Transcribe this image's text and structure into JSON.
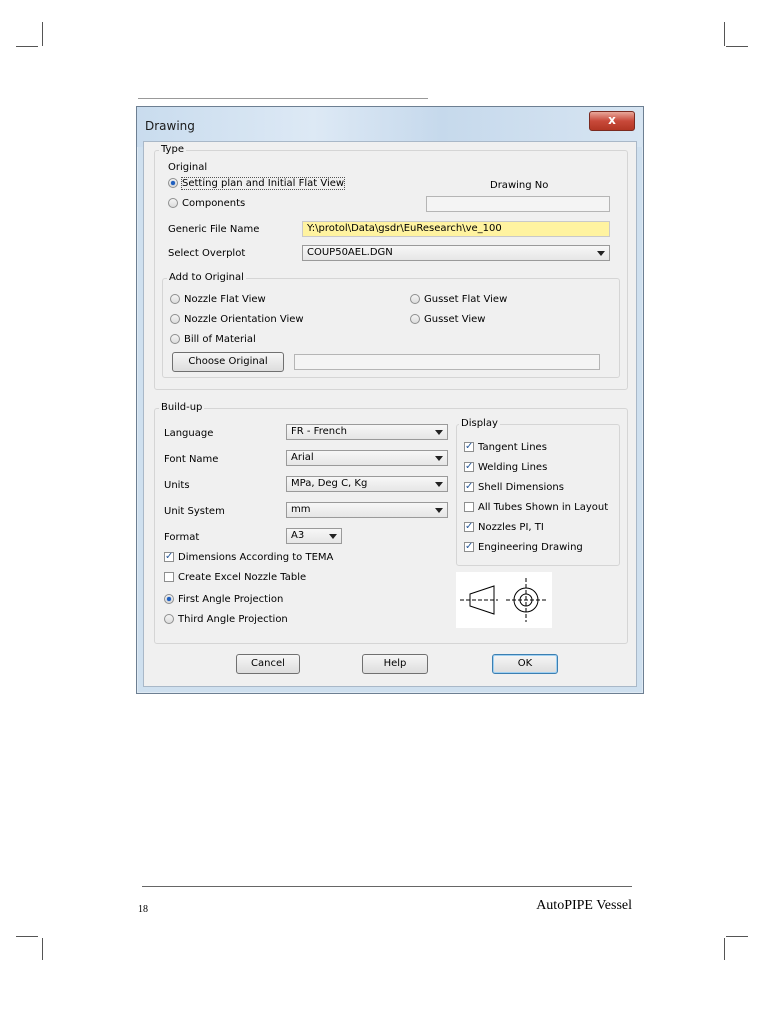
{
  "window": {
    "title": "Drawing",
    "close_label": "x"
  },
  "type_group": {
    "legend": "Type",
    "original_label": "Original",
    "radio_setting_plan": "Setting plan and Initial Flat View",
    "radio_components": "Components",
    "drawing_no_label": "Drawing No",
    "drawing_no_value": "",
    "generic_file_label": "Generic File Name",
    "generic_file_value": "Y:\\protol\\Data\\gsdr\\EuResearch\\ve_100",
    "select_overplot_label": "Select Overplot",
    "select_overplot_value": "COUP50AEL.DGN"
  },
  "add_group": {
    "legend": "Add to Original",
    "nozzle_flat": "Nozzle Flat View",
    "nozzle_orientation": "Nozzle Orientation View",
    "bill_of_material": "Bill of Material",
    "gusset_flat": "Gusset Flat View",
    "gusset_view": "Gusset View",
    "choose_original_button": "Choose Original",
    "choose_original_value": ""
  },
  "buildup_group": {
    "legend": "Build-up",
    "language_label": "Language",
    "language_value": "FR - French",
    "font_label": "Font Name",
    "font_value": "Arial",
    "units_label": "Units",
    "units_value": "MPa, Deg C, Kg",
    "unit_system_label": "Unit System",
    "unit_system_value": "mm",
    "format_label": "Format",
    "format_value": "A3",
    "dimensions_tema": "Dimensions According to TEMA",
    "create_excel": "Create Excel Nozzle Table",
    "first_angle": "First Angle Projection",
    "third_angle": "Third Angle Projection"
  },
  "display_group": {
    "legend": "Display",
    "tangent_lines": "Tangent Lines",
    "welding_lines": "Welding Lines",
    "shell_dimensions": "Shell Dimensions",
    "all_tubes": "All Tubes Shown in Layout",
    "nozzles_pi": "Nozzles PI, TI",
    "engineering_drawing": "Engineering Drawing"
  },
  "buttons": {
    "cancel": "Cancel",
    "help": "Help",
    "ok": "OK"
  },
  "footer": {
    "page_number": "18",
    "doc_title": "AutoPIPE Vessel"
  },
  "check_mark": "✓"
}
